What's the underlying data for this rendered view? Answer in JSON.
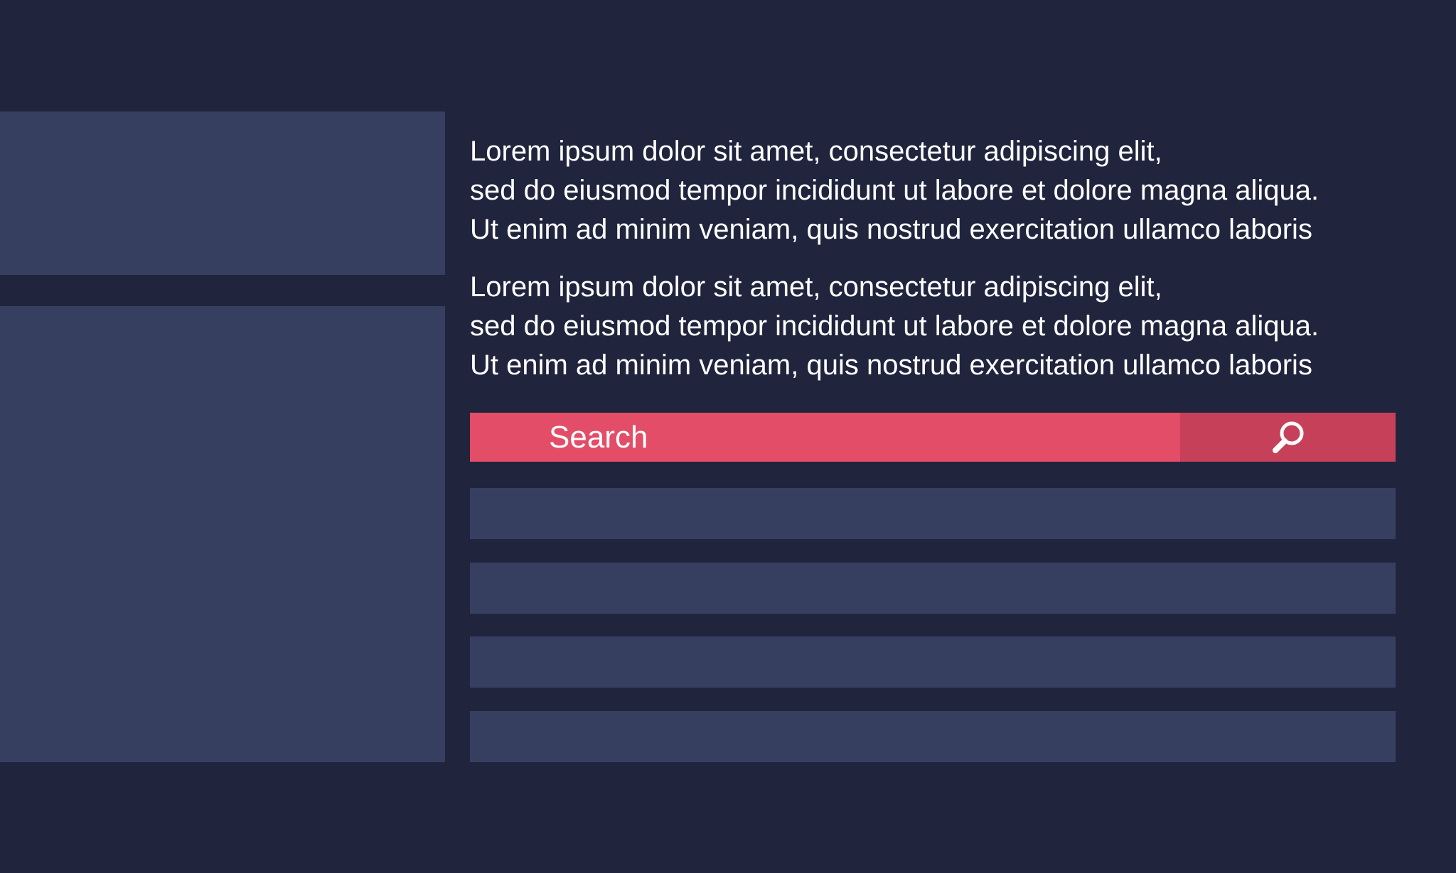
{
  "paragraphs": [
    {
      "lines": [
        "Lorem ipsum dolor sit amet, consectetur adipiscing elit,",
        "sed do eiusmod tempor incididunt ut labore et dolore magna aliqua.",
        "Ut enim ad minim veniam, quis nostrud exercitation ullamco laboris"
      ]
    },
    {
      "lines": [
        "Lorem ipsum dolor sit amet, consectetur adipiscing elit,",
        "sed do eiusmod tempor incididunt ut labore et dolore magna aliqua.",
        "Ut enim ad minim veniam, quis nostrud exercitation ullamco laboris"
      ]
    }
  ],
  "search": {
    "placeholder": "Search",
    "button_icon": "search-icon"
  },
  "colors": {
    "background": "#20243d",
    "panel": "#373f61",
    "search_bar": "#e44d67",
    "search_button": "#c7405a",
    "text": "#ffffff"
  }
}
